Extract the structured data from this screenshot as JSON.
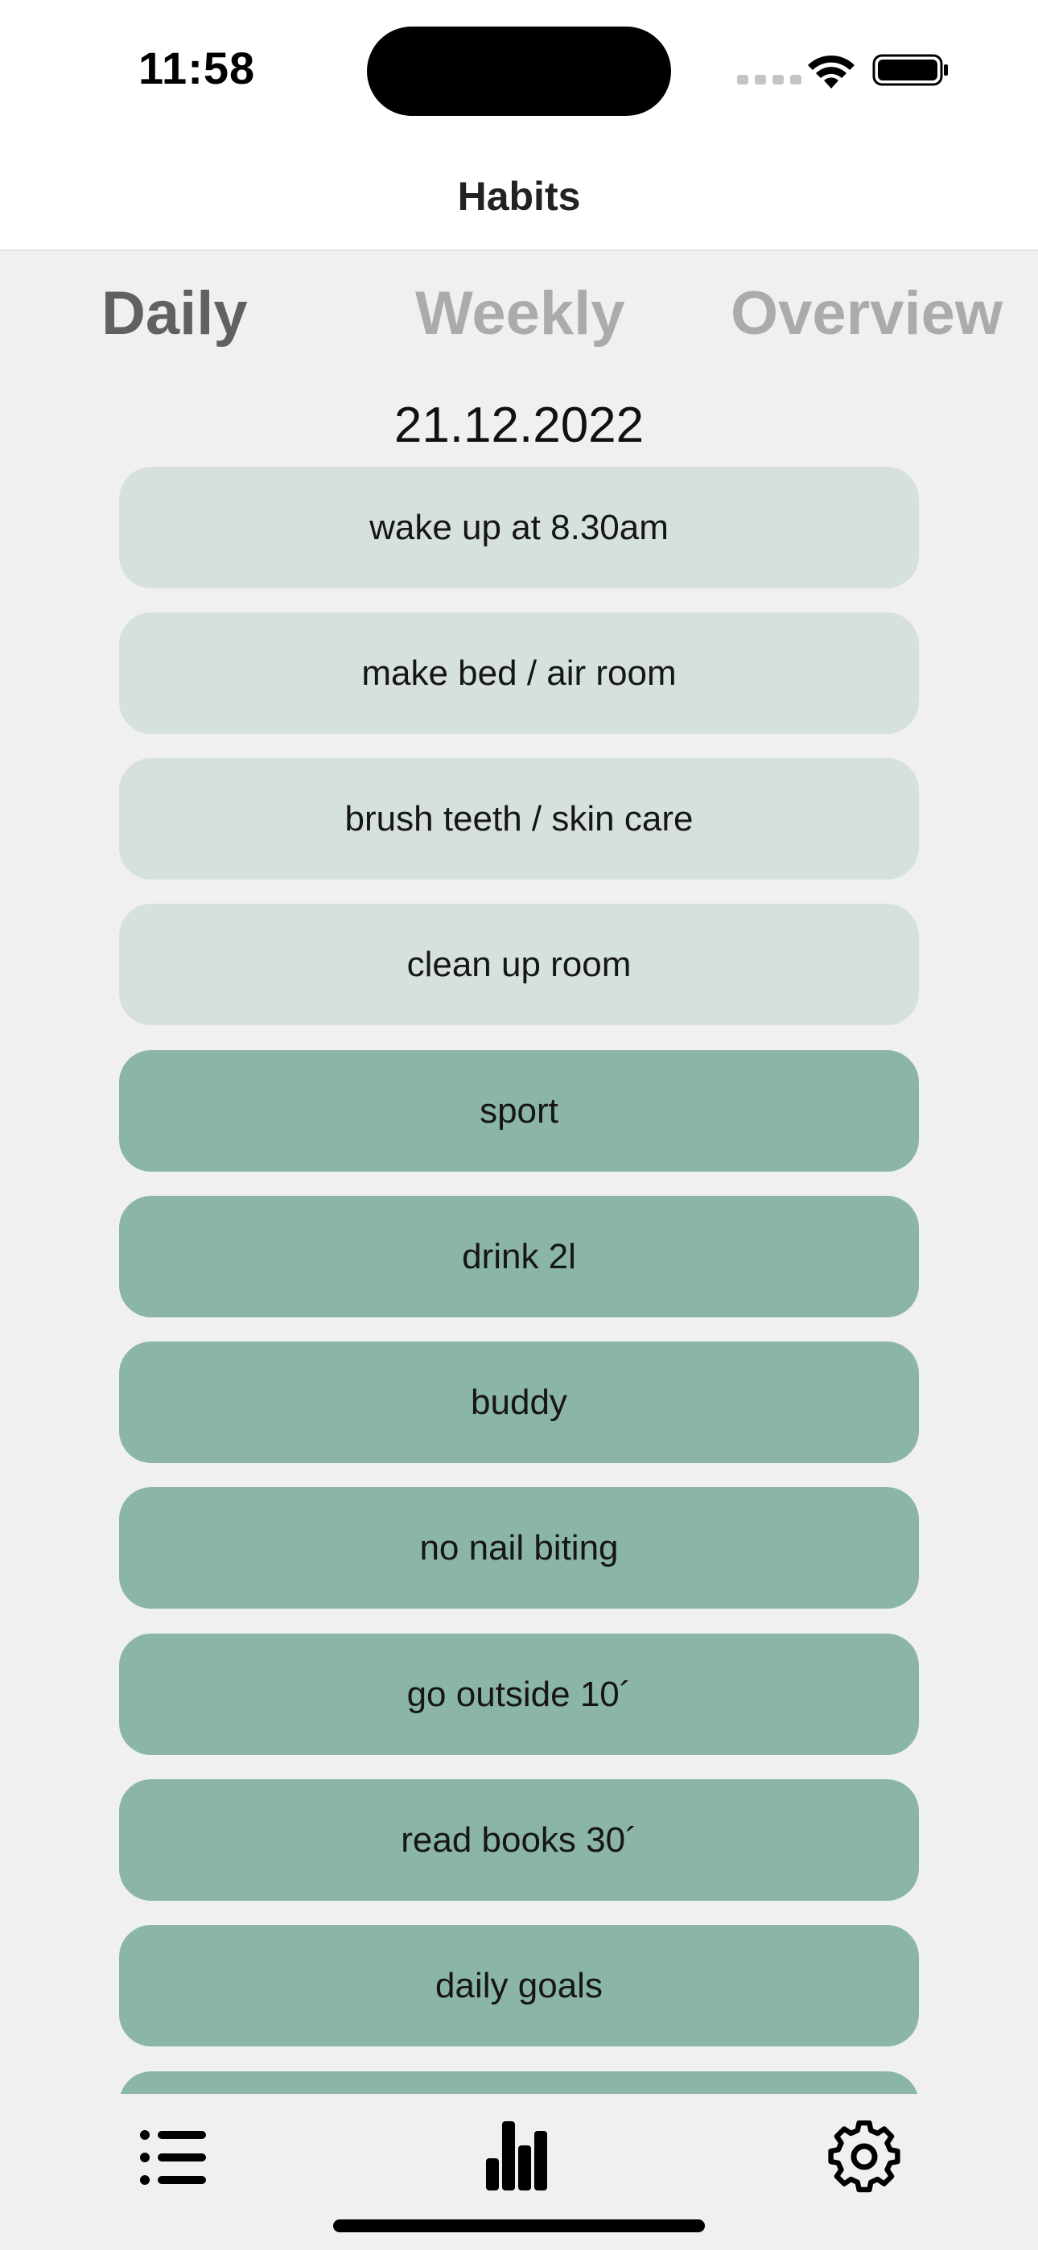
{
  "status_bar": {
    "time": "11:58"
  },
  "nav": {
    "title": "Habits"
  },
  "tabs": [
    {
      "label": "Daily",
      "active": true
    },
    {
      "label": "Weekly",
      "active": false
    },
    {
      "label": "Overview",
      "active": false
    }
  ],
  "date": "21.12.2022",
  "habits": [
    {
      "label": "wake up at 8.30am",
      "done": false
    },
    {
      "label": "make bed / air room",
      "done": false
    },
    {
      "label": "brush teeth / skin care",
      "done": false
    },
    {
      "label": "clean up room",
      "done": false
    },
    {
      "label": "sport",
      "done": true
    },
    {
      "label": "drink 2l",
      "done": true
    },
    {
      "label": "buddy",
      "done": true
    },
    {
      "label": "no nail biting",
      "done": true
    },
    {
      "label": "go outside 10´",
      "done": true
    },
    {
      "label": "read books 30´",
      "done": true
    },
    {
      "label": "daily goals",
      "done": true
    },
    {
      "label": "",
      "done": true
    }
  ],
  "colors": {
    "done": "#8ab5a7",
    "not_done": "#d6e1de",
    "tab_active": "#616161",
    "tab_inactive": "#ababab"
  },
  "tab_bar": {
    "items": [
      {
        "icon": "list-icon"
      },
      {
        "icon": "bar-chart-icon"
      },
      {
        "icon": "gear-icon"
      }
    ]
  }
}
